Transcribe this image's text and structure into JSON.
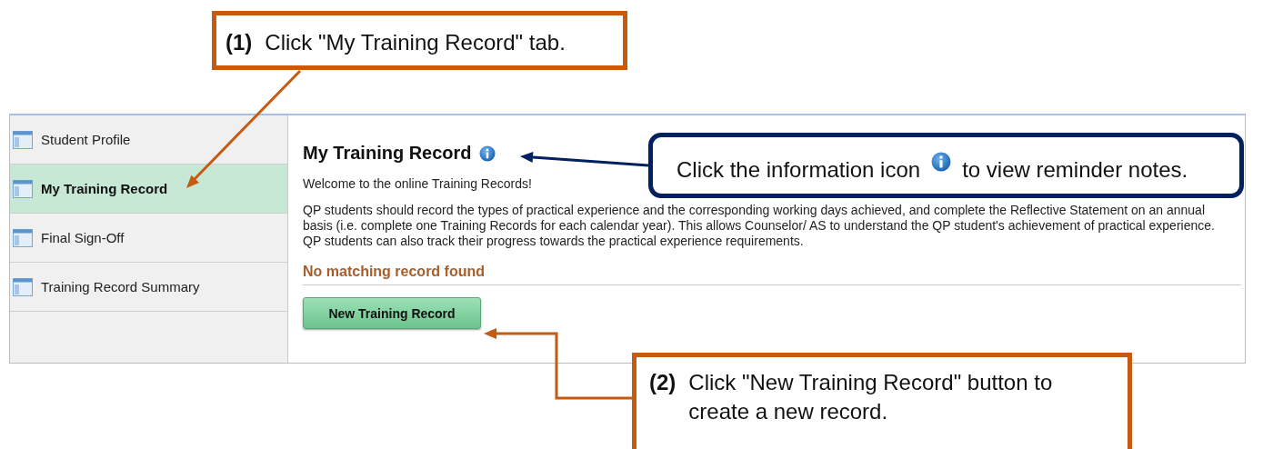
{
  "callouts": [
    {
      "kind": "step",
      "number": "(1)",
      "text": "Click \"My Training Record\" tab."
    },
    {
      "kind": "info",
      "text_before": "Click the information icon",
      "text_after": "to view reminder notes."
    },
    {
      "kind": "step",
      "number": "(2)",
      "text": "Click \"New Training Record\" button to create a new record."
    }
  ],
  "sidebar": {
    "items": [
      {
        "label": "Student Profile",
        "selected": false
      },
      {
        "label": "My Training Record",
        "selected": true
      },
      {
        "label": "Final Sign-Off",
        "selected": false
      },
      {
        "label": "Training Record Summary",
        "selected": false
      }
    ]
  },
  "main": {
    "title": "My Training Record",
    "welcome": "Welcome to the online Training Records!",
    "description": "QP students should record the types of practical experience and the corresponding working days achieved, and complete the Reflective Statement on an annual basis (i.e. complete one Training Records for each calendar year).  This allows Counselor/ AS to understand the QP student's achievement of practical experience.  QP students can also track their progress towards the practical experience requirements.",
    "status": "No matching record found",
    "button": "New Training Record"
  }
}
